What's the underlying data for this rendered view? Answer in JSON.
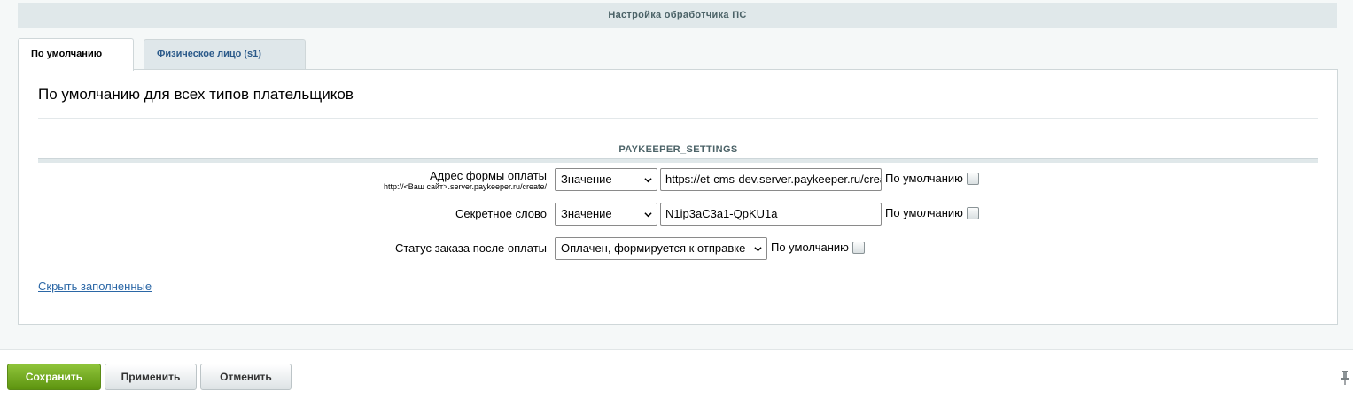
{
  "header": {
    "title": "Настройка обработчика ПС"
  },
  "tabs": [
    {
      "label": "По умолчанию",
      "active": true
    },
    {
      "label": "Физическое лицо (s1)",
      "active": false
    }
  ],
  "panel": {
    "title": "По умолчанию для всех типов плательщиков",
    "group_title": "PAYKEEPER_SETTINGS",
    "fields": [
      {
        "label": "Адрес формы оплаты",
        "hint": "http://<Ваш сайт>.server.paykeeper.ru/create/",
        "type_select": "Значение",
        "value": "https://et-cms-dev.server.paykeeper.ru/create/",
        "default_label": "По умолчанию",
        "default_checked": false
      },
      {
        "label": "Секретное слово",
        "type_select": "Значение",
        "value": "N1ip3aC3a1-QpKU1a",
        "default_label": "По умолчанию",
        "default_checked": false
      },
      {
        "label": "Статус заказа после оплаты",
        "status_select": "Оплачен, формируется к отправке",
        "default_label": "По умолчанию",
        "default_checked": false
      }
    ],
    "hide_filled_link": "Скрыть заполненные"
  },
  "buttons": {
    "save": "Сохранить",
    "apply": "Применить",
    "cancel": "Отменить"
  },
  "colors": {
    "save_button": "#6ea71e",
    "link": "#2b67a6",
    "header_bg": "#e0e8ea"
  }
}
